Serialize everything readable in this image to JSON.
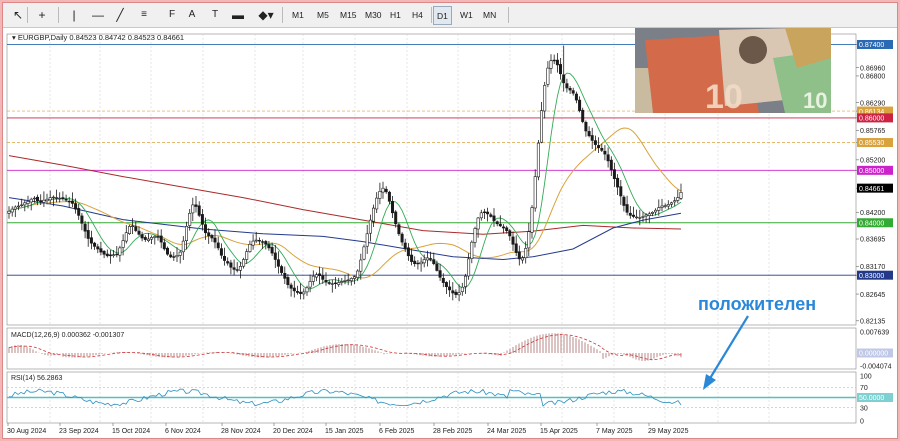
{
  "toolbar": {
    "tools": [
      {
        "name": "cursor-icon",
        "glyph": "↖"
      },
      {
        "name": "crosshair-icon",
        "glyph": "+"
      },
      {
        "name": "vertical-line-icon",
        "glyph": "|"
      },
      {
        "name": "horizontal-line-icon",
        "glyph": "—"
      },
      {
        "name": "trendline-icon",
        "glyph": "╱"
      },
      {
        "name": "channel-icon",
        "glyph": "≡"
      },
      {
        "name": "fibonacci-icon",
        "glyph": "F"
      },
      {
        "name": "text-tool-icon",
        "glyph": "A"
      },
      {
        "name": "text-label-icon",
        "glyph": "T"
      },
      {
        "name": "rectangle-icon",
        "glyph": "▬"
      },
      {
        "name": "shapes-menu-icon",
        "glyph": "◆▾"
      }
    ],
    "timeframes": [
      "M1",
      "M5",
      "M15",
      "M30",
      "H1",
      "H4",
      "D1",
      "W1",
      "MN"
    ],
    "active_timeframe": "D1"
  },
  "chart": {
    "header": "EURGBP,Daily  0.84523 0.84742 0.84523 0.84661",
    "annotation": "положителен",
    "colors": {
      "up": "#1a1a1a",
      "down": "#1a1a1a",
      "ma_fast": "#33aa55",
      "ma_mid": "#d9a23c",
      "ma_slow": "#243a8c",
      "ma_long": "#aa2a2a",
      "macd_hist": "#bb8888",
      "macd_signal": "#cc3333",
      "rsi_line": "#2a8fbf",
      "rsi_band": "#55c0c0",
      "arrow": "#2b88d8",
      "level_blue": "#2a6ab5",
      "level_red": "#cc2244",
      "level_magenta": "#cc22cc",
      "level_green": "#33aa33",
      "level_navy": "#233a8a"
    }
  },
  "chart_data": {
    "type": "candlestick",
    "symbol": "EURGBP",
    "period": "Daily",
    "ohlc_last": {
      "open": 0.84523,
      "high": 0.84742,
      "low": 0.84523,
      "close": 0.84661
    },
    "price_axis_ticks": [
      "0.87400",
      "0.86960",
      "0.86800",
      "0.86290",
      "0.86134",
      "0.86000",
      "0.85765",
      "0.85530",
      "0.85200",
      "0.85000",
      "0.84661",
      "0.84200",
      "0.84000",
      "0.83695",
      "0.83170",
      "0.83000",
      "0.82645",
      "0.82135"
    ],
    "time_axis_labels": [
      "30 Aug 2024",
      "23 Sep 2024",
      "15 Oct 2024",
      "6 Nov 2024",
      "28 Nov 2024",
      "20 Dec 2024",
      "15 Jan 2025",
      "6 Feb 2025",
      "28 Feb 2025",
      "24 Mar 2025",
      "15 Apr 2025",
      "7 May 2025",
      "29 May 2025"
    ],
    "ylim": [
      0.8205,
      0.876
    ],
    "horizontal_levels": [
      {
        "price": 0.874,
        "label": "0.87400",
        "color_key": "level_blue"
      },
      {
        "price": 0.8613,
        "label": "0.86134",
        "color_key": "ma_mid"
      },
      {
        "price": 0.86,
        "label": "0.86000",
        "color_key": "level_red"
      },
      {
        "price": 0.8553,
        "label": "0.85530",
        "color_key": "ma_mid"
      },
      {
        "price": 0.85,
        "label": "0.85000",
        "color_key": "level_magenta"
      },
      {
        "price": 0.84,
        "label": "0.84000",
        "color_key": "level_green"
      },
      {
        "price": 0.83,
        "label": "0.83000",
        "color_key": "level_navy"
      }
    ],
    "closes": [
      0.8422,
      0.8426,
      0.843,
      0.8432,
      0.8434,
      0.8438,
      0.8441,
      0.8445,
      0.8447,
      0.8442,
      0.844,
      0.8443,
      0.8445,
      0.8448,
      0.8449,
      0.8448,
      0.8447,
      0.8446,
      0.8443,
      0.8441,
      0.8437,
      0.8426,
      0.8414,
      0.8399,
      0.8384,
      0.837,
      0.8361,
      0.8355,
      0.835,
      0.8344,
      0.834,
      0.8337,
      0.8337,
      0.8339,
      0.834,
      0.8352,
      0.8366,
      0.8381,
      0.8393,
      0.8394,
      0.8385,
      0.8378,
      0.8371,
      0.8368,
      0.8369,
      0.8372,
      0.8374,
      0.8373,
      0.8363,
      0.835,
      0.834,
      0.8335,
      0.8335,
      0.8338,
      0.8344,
      0.8365,
      0.8393,
      0.8418,
      0.8434,
      0.8431,
      0.8414,
      0.8397,
      0.8381,
      0.8375,
      0.8371,
      0.8363,
      0.8352,
      0.8338,
      0.8328,
      0.8323,
      0.8315,
      0.8311,
      0.831,
      0.8317,
      0.833,
      0.8345,
      0.8359,
      0.8365,
      0.8367,
      0.8366,
      0.8363,
      0.8359,
      0.8352,
      0.8342,
      0.833,
      0.8317,
      0.8305,
      0.8294,
      0.8282,
      0.8275,
      0.827,
      0.8267,
      0.8265,
      0.8268,
      0.8276,
      0.8288,
      0.8298,
      0.8301,
      0.8299,
      0.8292,
      0.8287,
      0.8284,
      0.8284,
      0.8284,
      0.8286,
      0.8288,
      0.829,
      0.8291,
      0.8294,
      0.8297,
      0.8308,
      0.8329,
      0.8354,
      0.8379,
      0.8405,
      0.8428,
      0.8447,
      0.846,
      0.8466,
      0.8459,
      0.8441,
      0.8419,
      0.8398,
      0.8379,
      0.8363,
      0.8351,
      0.8337,
      0.8326,
      0.8322,
      0.8322,
      0.8325,
      0.833,
      0.8333,
      0.833,
      0.8322,
      0.8309,
      0.8296,
      0.8286,
      0.8278,
      0.8272,
      0.8266,
      0.8263,
      0.8267,
      0.8277,
      0.8298,
      0.8331,
      0.8363,
      0.8389,
      0.8409,
      0.8419,
      0.842,
      0.8417,
      0.8412,
      0.8404,
      0.8398,
      0.8394,
      0.839,
      0.8385,
      0.8375,
      0.8359,
      0.8343,
      0.8331,
      0.8333,
      0.8351,
      0.8383,
      0.8429,
      0.8488,
      0.8552,
      0.8614,
      0.8662,
      0.8695,
      0.8709,
      0.8709,
      0.8701,
      0.8684,
      0.8667,
      0.8657,
      0.8653,
      0.8647,
      0.8634,
      0.8614,
      0.8593,
      0.8575,
      0.8566,
      0.8557,
      0.8549,
      0.8543,
      0.8538,
      0.8531,
      0.8518,
      0.8501,
      0.8484,
      0.8468,
      0.8451,
      0.8433,
      0.842,
      0.8414,
      0.8412,
      0.8411,
      0.841,
      0.8412,
      0.8415,
      0.8417,
      0.842,
      0.8424,
      0.8429,
      0.8432,
      0.8433,
      0.8435,
      0.8438,
      0.8442,
      0.8448,
      0.8458
    ],
    "indicators": [
      {
        "name": "MACD(12,26,9)",
        "values": [
          "0.000362",
          "-0.001307"
        ],
        "ticks": [
          "0.007639",
          "0.000000",
          "-0.004074"
        ]
      },
      {
        "name": "RSI(14)",
        "value": "56.2863",
        "ticks": [
          "100",
          "70",
          "50.0000",
          "30",
          "0"
        ]
      }
    ]
  }
}
